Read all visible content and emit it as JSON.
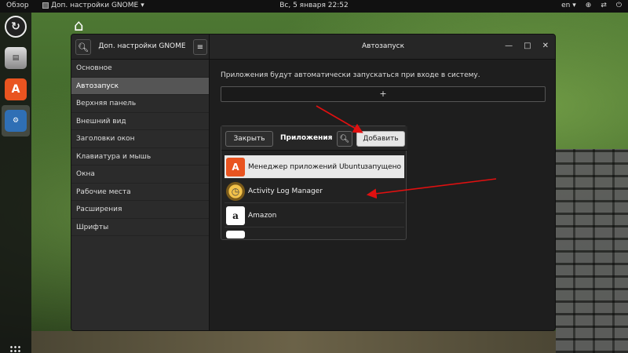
{
  "topbar": {
    "activities": "Обзор",
    "app_name": "Доп. настройки GNOME",
    "clock": "Вс, 5 января  22:52",
    "keyboard_layout": "en"
  },
  "window": {
    "sidebar_title": "Доп. настройки GNOME",
    "main_title": "Автозапуск",
    "sidebar_items": [
      {
        "label": "Основное"
      },
      {
        "label": "Автозапуск",
        "active": true
      },
      {
        "label": "Верхняя панель"
      },
      {
        "label": "Внешний вид"
      },
      {
        "label": "Заголовки окон"
      },
      {
        "label": "Клавиатура и мышь"
      },
      {
        "label": "Окна"
      },
      {
        "label": "Рабочие места"
      },
      {
        "label": "Расширения"
      },
      {
        "label": "Шрифты"
      }
    ],
    "description": "Приложения будут автоматически запускаться при входе в систему.",
    "add_row_symbol": "+"
  },
  "dialog": {
    "close_label": "Закрыть",
    "title": "Приложения",
    "add_label": "Добавить",
    "apps": [
      {
        "name": "Менеджер приложений Ubuntu",
        "status": "запущено",
        "icon": "ubuntu-software-icon",
        "selected": true
      },
      {
        "name": "Activity Log Manager",
        "status": "",
        "icon": "activity-log-icon",
        "selected": false
      },
      {
        "name": "Amazon",
        "status": "",
        "icon": "amazon-icon",
        "selected": false
      }
    ]
  },
  "annotations": {
    "arrow_color": "#e01010"
  }
}
